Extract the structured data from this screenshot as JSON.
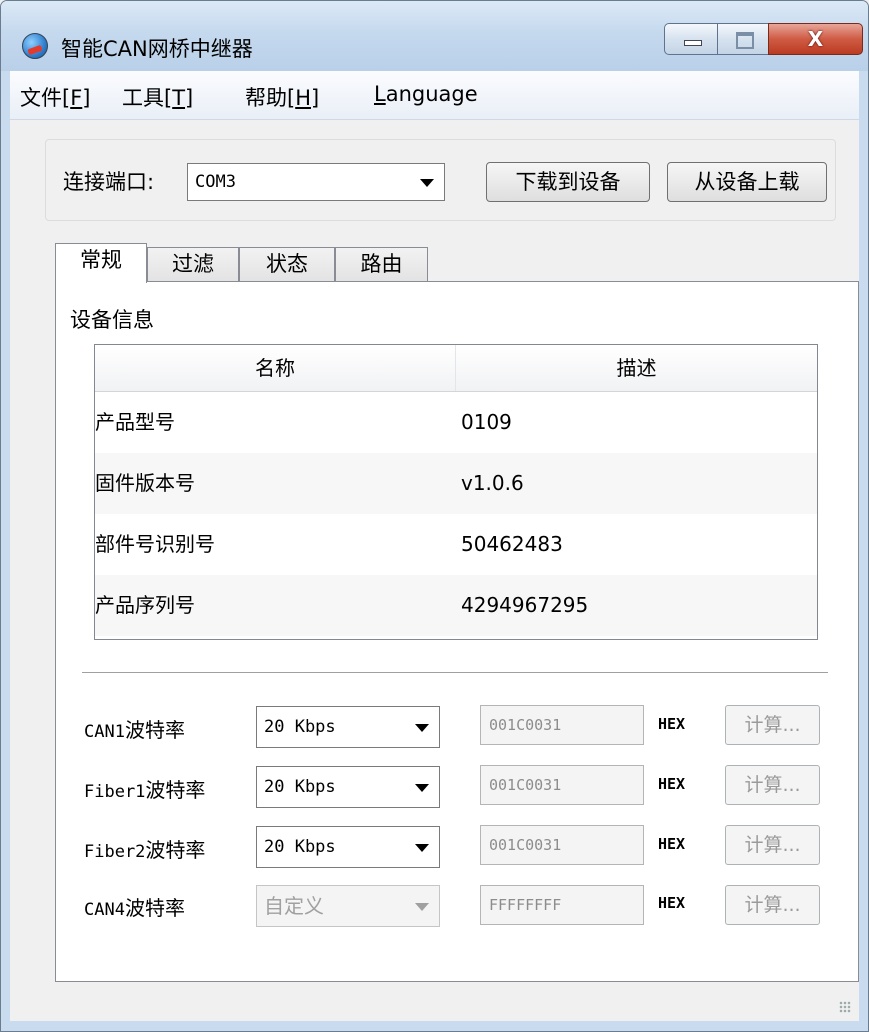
{
  "window": {
    "title": "智能CAN网桥中继器",
    "close_glyph": "X"
  },
  "menu": [
    {
      "label": "文件[",
      "key": "F",
      "suffix": "]"
    },
    {
      "label": "工具[",
      "key": "T",
      "suffix": "]"
    },
    {
      "label": "帮助[",
      "key": "H",
      "suffix": "]"
    },
    {
      "label": "",
      "key": "L",
      "suffix": "anguage"
    }
  ],
  "connection": {
    "port_label": "连接端口:",
    "port_value": "COM3",
    "download_button": "下载到设备",
    "upload_button": "从设备上载"
  },
  "tabs": [
    "常规",
    "过滤",
    "状态",
    "路由"
  ],
  "active_tab": 0,
  "device_info": {
    "section_label": "设备信息",
    "columns": [
      "名称",
      "描述"
    ],
    "rows": [
      [
        "产品型号",
        "0109"
      ],
      [
        "固件版本号",
        "v1.0.6"
      ],
      [
        "部件号识别号",
        "50462483"
      ],
      [
        "产品序列号",
        "4294967295"
      ]
    ]
  },
  "baud_rates": [
    {
      "prefix": "CAN1",
      "suffix": "波特率",
      "value": "20 Kbps",
      "hex": "001C0031",
      "unit": "HEX",
      "calc": "计算...",
      "enabled": true
    },
    {
      "prefix": "Fiber1",
      "suffix": "波特率",
      "value": "20 Kbps",
      "hex": "001C0031",
      "unit": "HEX",
      "calc": "计算...",
      "enabled": true
    },
    {
      "prefix": "Fiber2",
      "suffix": "波特率",
      "value": "20 Kbps",
      "hex": "001C0031",
      "unit": "HEX",
      "calc": "计算...",
      "enabled": true
    },
    {
      "prefix": "CAN4",
      "suffix": "波特率",
      "value": "自定义",
      "hex": "FFFFFFFF",
      "unit": "HEX",
      "calc": "计算...",
      "enabled": false
    }
  ]
}
